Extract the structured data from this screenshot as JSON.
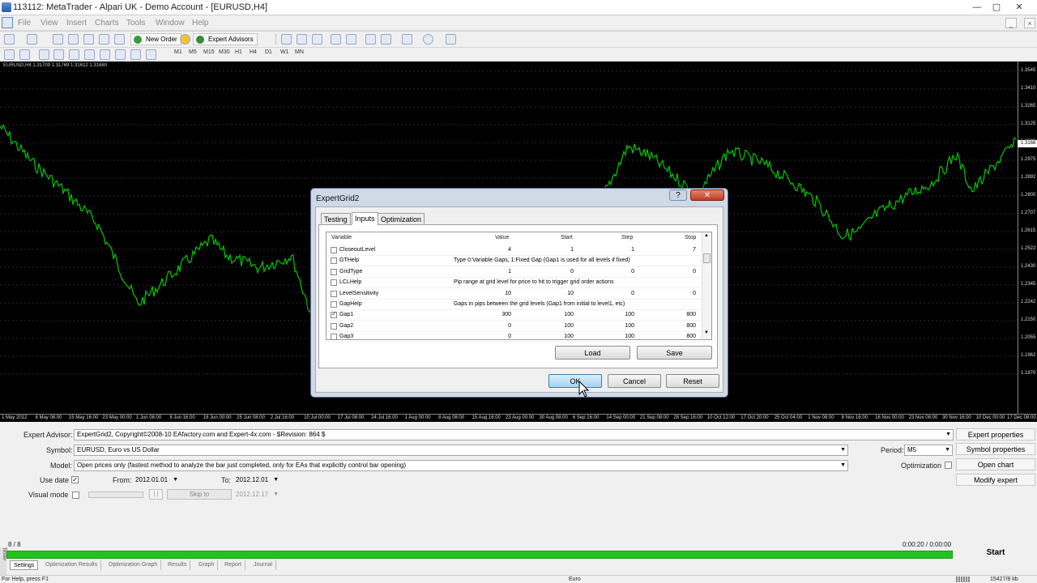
{
  "window": {
    "title": "113112: MetaTrader - Alpari UK - Demo Account - [EURUSD,H4]",
    "min": "—",
    "max": "▢",
    "close": "✕"
  },
  "menu": [
    "File",
    "View",
    "Insert",
    "Charts",
    "Tools",
    "Window",
    "Help"
  ],
  "toolbar": {
    "new_order": "New Order",
    "expert_advisors": "Expert Advisors",
    "timeframes": [
      "M1",
      "M5",
      "M15",
      "M30",
      "H1",
      "H4",
      "D1",
      "W1",
      "MN"
    ]
  },
  "chart": {
    "info": "EURUSD,H4  1.31709 1.31769 1.31612 1.31680",
    "price_ticks": [
      "1.3545",
      "1.3410",
      "1.3265",
      "1.3125",
      "1.3000",
      "1.2975",
      "1.2892",
      "1.2800",
      "1.2707",
      "1.2615",
      "1.2522",
      "1.2430",
      "1.2345",
      "1.2242",
      "1.2150",
      "1.2055",
      "1.1962",
      "1.1870"
    ],
    "current_price": "1.3168",
    "time_ticks": [
      "1 May 2012",
      "8 May 08:00",
      "15 May 16:00",
      "23 May 00:00",
      "1 Jun 08:00",
      "8 Jun 16:00",
      "18 Jun 00:00",
      "25 Jun 08:00",
      "2 Jul 16:00",
      "10 Jul 00:00",
      "17 Jul 08:00",
      "24 Jul 16:00",
      "1 Aug 00:00",
      "8 Aug 08:00",
      "15 Aug 16:00",
      "23 Aug 00:00",
      "30 Aug 08:00",
      "6 Sep 16:00",
      "14 Sep 00:00",
      "21 Sep 08:00",
      "28 Sep 16:00",
      "10 Oct 12:00",
      "17 Oct 20:00",
      "25 Oct 04:00",
      "1 Nov 08:00",
      "8 Nov 16:00",
      "16 Nov 00:00",
      "23 Nov 08:00",
      "30 Nov 16:00",
      "10 Dec 00:00",
      "17 Dec 08:00"
    ],
    "line_color": "#00c800"
  },
  "dialog": {
    "title": "ExpertGrid2",
    "help": "?",
    "close": "✕",
    "tabs": [
      "Testing",
      "Inputs",
      "Optimization"
    ],
    "columns": [
      "Variable",
      "Value",
      "Start",
      "Step",
      "Stop"
    ],
    "rows": [
      {
        "name": "CloseoutLevel",
        "checked": false,
        "value": "4",
        "start": "1",
        "step": "1",
        "stop": "7"
      },
      {
        "name": "GTHelp",
        "checked": false,
        "help": "Type 0:Variable Gaps, 1:Fixed Gap (Gap1 is used for all levels if fixed)"
      },
      {
        "name": "GridType",
        "checked": false,
        "value": "1",
        "start": "0",
        "step": "0",
        "stop": "0"
      },
      {
        "name": "LCLHelp",
        "checked": false,
        "help": "Pip range at grid level for price to hit to trigger grid order actions"
      },
      {
        "name": "LevelSensitivity",
        "checked": false,
        "value": "10",
        "start": "10",
        "step": "0",
        "stop": "0"
      },
      {
        "name": "GapHelp",
        "checked": false,
        "help": "Gaps in pips between the grid levels (Gap1 from initial to level1, etc)"
      },
      {
        "name": "Gap1",
        "checked": true,
        "value": "300",
        "start": "100",
        "step": "100",
        "stop": "800"
      },
      {
        "name": "Gap2",
        "checked": false,
        "value": "0",
        "start": "100",
        "step": "100",
        "stop": "800"
      },
      {
        "name": "Gap3",
        "checked": false,
        "value": "0",
        "start": "100",
        "step": "100",
        "stop": "800"
      }
    ],
    "load": "Load",
    "save": "Save",
    "ok": "OK",
    "cancel": "Cancel",
    "reset": "Reset"
  },
  "tester": {
    "ea_label": "Expert Advisor:",
    "ea_value": "ExpertGrid2, Copyright©2008-10 EAfactory.com and Expert-4x.com - $Revision: 864 $",
    "symbol_label": "Symbol:",
    "symbol_value": "EURUSD, Euro vs US Dollar",
    "model_label": "Model:",
    "model_value": "Open prices only (fastest method to analyze the bar just completed, only for EAs that explicitly control bar opening)",
    "use_date_label": "Use date",
    "from_label": "From:",
    "from_value": "2012.01.01",
    "to_label": "To:",
    "to_value": "2012.12.01",
    "visual_label": "Visual mode",
    "pause": "| |",
    "skip_to": "Skip to",
    "skip_date": "2012.12.17",
    "period_label": "Period:",
    "period_value": "M5",
    "optimization_label": "Optimization",
    "buttons": [
      "Expert properties",
      "Symbol properties",
      "Open chart",
      "Modify expert"
    ],
    "count": "8 / 8",
    "time": "0:00:20 / 0:00:00",
    "progress": 1.0,
    "start": "Start",
    "tabs": [
      "Settings",
      "Optimization Results",
      "Optimization Graph",
      "Results",
      "Graph",
      "Report",
      "Journal"
    ],
    "side_label": "Tester"
  },
  "status": {
    "help": "For Help, press F1",
    "profile": "Euro",
    "traffic": "15427/8 kb"
  }
}
